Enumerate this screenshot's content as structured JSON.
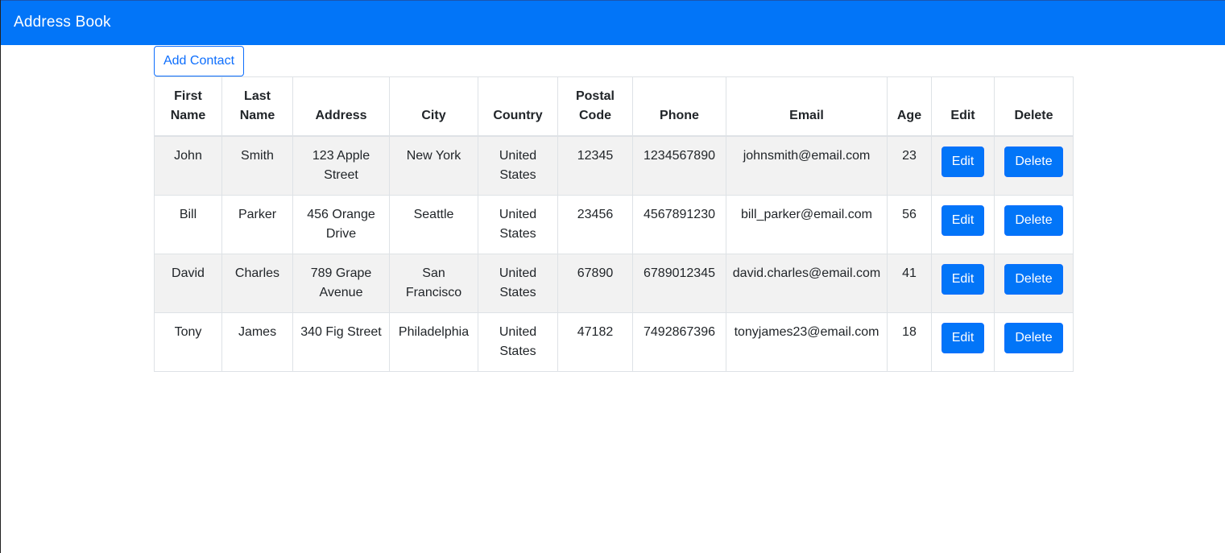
{
  "navbar": {
    "brand": "Address Book"
  },
  "toolbar": {
    "add_label": "Add Contact"
  },
  "table": {
    "headers": [
      "First Name",
      "Last Name",
      "Address",
      "City",
      "Country",
      "Postal Code",
      "Phone",
      "Email",
      "Age",
      "Edit",
      "Delete"
    ],
    "rows": [
      {
        "first": "John",
        "last": "Smith",
        "address": "123 Apple Street",
        "city": "New York",
        "country": "United States",
        "postal": "12345",
        "phone": "1234567890",
        "email": "johnsmith@email.com",
        "age": "23",
        "edit_label": "Edit",
        "delete_label": "Delete"
      },
      {
        "first": "Bill",
        "last": "Parker",
        "address": "456 Orange Drive",
        "city": "Seattle",
        "country": "United States",
        "postal": "23456",
        "phone": "4567891230",
        "email": "bill_parker@email.com",
        "age": "56",
        "edit_label": "Edit",
        "delete_label": "Delete"
      },
      {
        "first": "David",
        "last": "Charles",
        "address": "789 Grape Avenue",
        "city": "San Francisco",
        "country": "United States",
        "postal": "67890",
        "phone": "6789012345",
        "email": "david.charles@email.com",
        "age": "41",
        "edit_label": "Edit",
        "delete_label": "Delete"
      },
      {
        "first": "Tony",
        "last": "James",
        "address": "340 Fig Street",
        "city": "Philadelphia",
        "country": "United States",
        "postal": "47182",
        "phone": "7492867396",
        "email": "tonyjames23@email.com",
        "age": "18",
        "edit_label": "Edit",
        "delete_label": "Delete"
      }
    ]
  },
  "colors": {
    "primary": "#0275f8",
    "stripe": "#f2f2f2"
  }
}
